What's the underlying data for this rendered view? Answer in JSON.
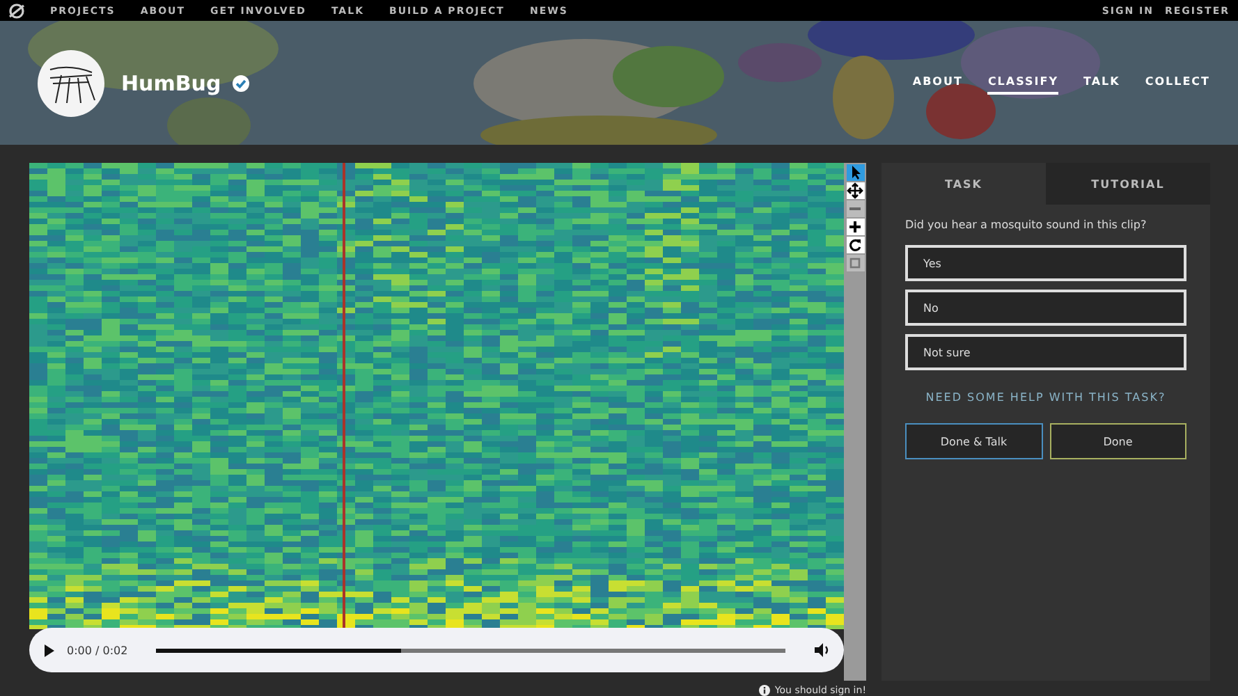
{
  "top_nav": {
    "links": [
      "PROJECTS",
      "ABOUT",
      "GET INVOLVED",
      "TALK",
      "BUILD A PROJECT",
      "NEWS"
    ],
    "account": [
      "SIGN IN",
      "REGISTER"
    ]
  },
  "project": {
    "title": "HumBug",
    "verified": true,
    "nav": [
      {
        "label": "ABOUT",
        "selected": false
      },
      {
        "label": "CLASSIFY",
        "selected": true
      },
      {
        "label": "TALK",
        "selected": false
      },
      {
        "label": "COLLECT",
        "selected": false
      }
    ]
  },
  "tools": [
    {
      "kind": "pointer",
      "selected": true,
      "disabled": false
    },
    {
      "kind": "move",
      "selected": false,
      "disabled": false
    },
    {
      "kind": "zoom-out",
      "selected": false,
      "disabled": true
    },
    {
      "kind": "zoom-in",
      "selected": false,
      "disabled": false
    },
    {
      "kind": "rotate",
      "selected": false,
      "disabled": false
    },
    {
      "kind": "reset",
      "selected": false,
      "disabled": true
    }
  ],
  "player": {
    "time": "0:00 / 0:02",
    "level": 0.39
  },
  "task_tabs": [
    {
      "label": "TASK",
      "selected": true
    },
    {
      "label": "TUTORIAL",
      "selected": false
    }
  ],
  "question": "Did you hear a mosquito sound in this clip?",
  "answers": [
    {
      "label": "Yes",
      "selected": false
    },
    {
      "label": "No",
      "selected": false
    },
    {
      "label": "Not sure",
      "selected": false
    }
  ],
  "help": "NEED SOME HELP WITH THIS TASK?",
  "actions": [
    {
      "label": "Done & Talk",
      "color": "#4a8fc0"
    },
    {
      "label": "Done",
      "color": "#a8b060"
    }
  ],
  "notice": "You should sign in!"
}
